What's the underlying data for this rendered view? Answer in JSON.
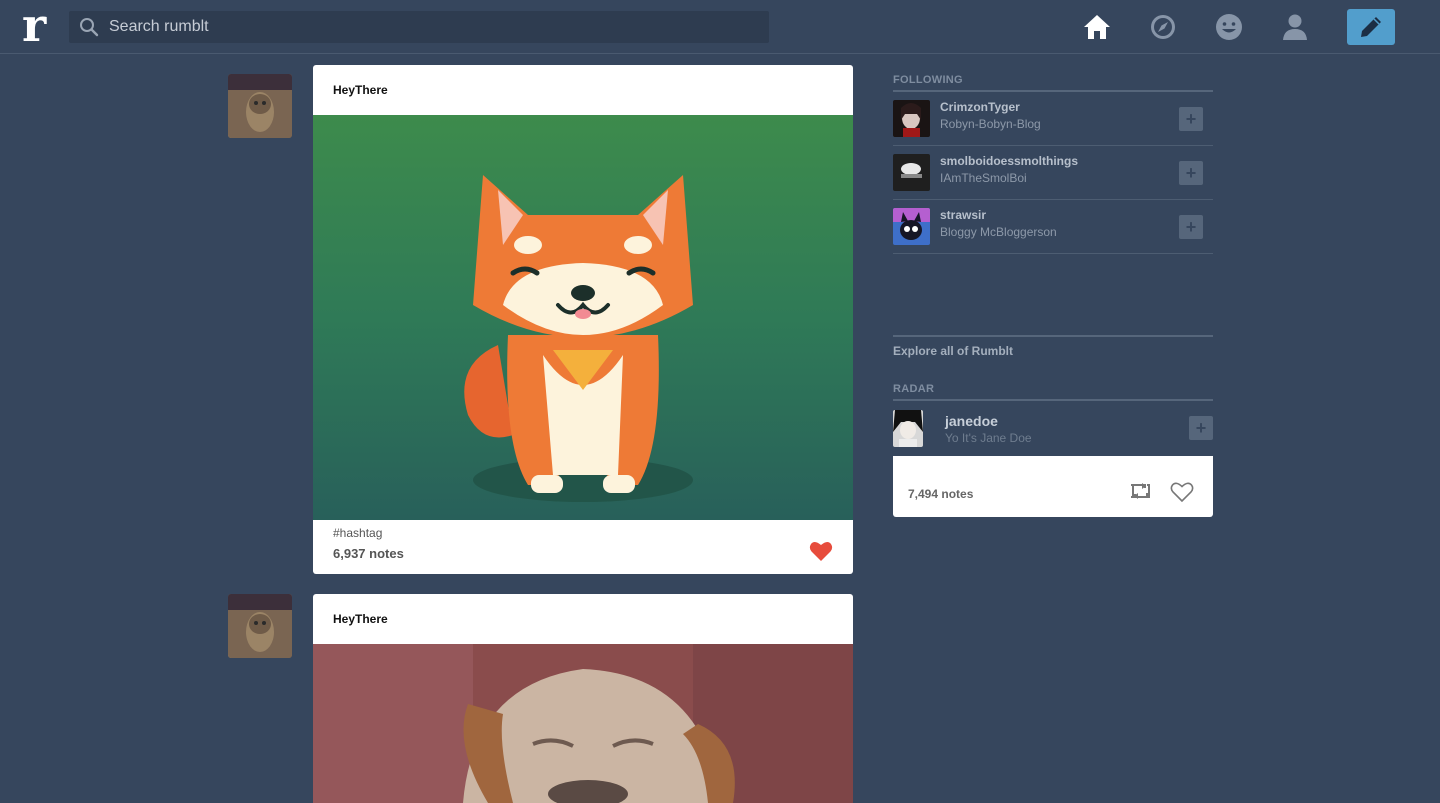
{
  "app": {
    "logo_letter": "r"
  },
  "search": {
    "placeholder": "Search rumblt"
  },
  "nav": {
    "icons": [
      "home-icon",
      "explore-compass-icon",
      "smiley-icon",
      "account-person-icon"
    ],
    "compose_icon": "pencil-icon",
    "accent_color": "#529ecc",
    "background_color": "#36465d"
  },
  "posts": [
    {
      "username": "HeyThere",
      "image_alt": "cartoon shiba inu dog",
      "hashtag": "#hashtag",
      "notes": "6,937 notes",
      "liked": true
    },
    {
      "username": "HeyThere",
      "image_alt": "photo of a squinting dog"
    }
  ],
  "sidebar": {
    "following_title": "FOLLOWING",
    "following": [
      {
        "name": "CrimzonTyger",
        "blog": "Robyn-Bobyn-Blog"
      },
      {
        "name": "smolboidoessmolthings",
        "blog": "IAmTheSmolBoi"
      },
      {
        "name": "strawsir",
        "blog": "Bloggy McBloggerson"
      }
    ],
    "follow_button": "+",
    "explore_link": "Explore all of Rumblt",
    "radar_title": "RADAR",
    "radar": {
      "name": "janedoe",
      "blog": "Yo It's Jane Doe",
      "notes": "7,494 notes"
    }
  }
}
